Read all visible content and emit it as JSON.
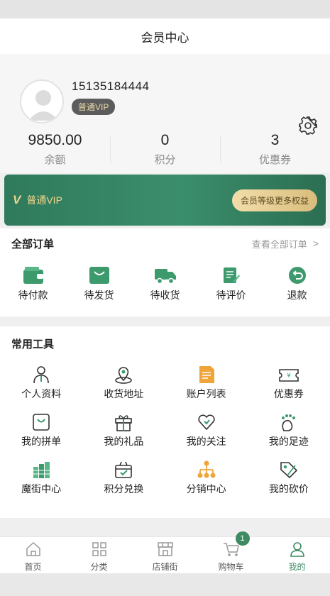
{
  "header": {
    "title": "会员中心"
  },
  "profile": {
    "phone": "15135184444",
    "level": "普通VIP"
  },
  "stats": [
    {
      "value": "9850.00",
      "label": "余额"
    },
    {
      "value": "0",
      "label": "积分"
    },
    {
      "value": "3",
      "label": "优惠券"
    }
  ],
  "vip_card": {
    "title": "普通VIP",
    "benefit_button": "会员等级更多权益"
  },
  "orders": {
    "title": "全部订单",
    "view_all": "查看全部订单",
    "items": [
      {
        "label": "待付款",
        "icon": "wallet-icon"
      },
      {
        "label": "待发货",
        "icon": "cart-icon"
      },
      {
        "label": "待收货",
        "icon": "truck-icon"
      },
      {
        "label": "待评价",
        "icon": "edit-icon"
      },
      {
        "label": "退款",
        "icon": "refund-icon"
      }
    ]
  },
  "tools": {
    "title": "常用工具",
    "items": [
      {
        "label": "个人资料",
        "icon": "user-icon"
      },
      {
        "label": "收货地址",
        "icon": "location-icon"
      },
      {
        "label": "账户列表",
        "icon": "document-icon"
      },
      {
        "label": "优惠券",
        "icon": "coupon-icon"
      },
      {
        "label": "我的拼单",
        "icon": "bag-icon"
      },
      {
        "label": "我的礼品",
        "icon": "gift-icon"
      },
      {
        "label": "我的关注",
        "icon": "heart-icon"
      },
      {
        "label": "我的足迹",
        "icon": "footprint-icon"
      },
      {
        "label": "魔街中心",
        "icon": "building-icon"
      },
      {
        "label": "积分兑换",
        "icon": "exchange-icon"
      },
      {
        "label": "分销中心",
        "icon": "network-icon"
      },
      {
        "label": "我的砍价",
        "icon": "tag-icon"
      }
    ]
  },
  "tabbar": [
    {
      "label": "首页",
      "icon": "home-icon"
    },
    {
      "label": "分类",
      "icon": "grid-icon"
    },
    {
      "label": "店铺街",
      "icon": "store-icon"
    },
    {
      "label": "购物车",
      "icon": "shopping-cart-icon",
      "badge": "1"
    },
    {
      "label": "我的",
      "icon": "person-icon",
      "active": true
    }
  ],
  "colors": {
    "accent": "#3d8a63",
    "gold": "#f0d58b",
    "orange": "#f0a53a"
  }
}
